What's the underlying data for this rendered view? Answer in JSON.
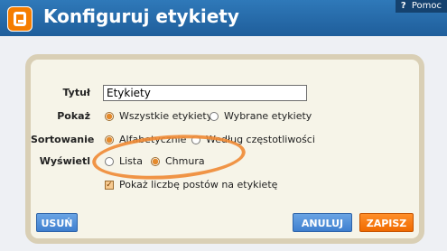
{
  "header": {
    "title": "Konfiguruj etykiety",
    "help_label": "Pomoc",
    "help_icon": "?"
  },
  "form": {
    "title_label": "Tytuł",
    "title_value": "Etykiety",
    "show_label": "Pokaż",
    "show_options": [
      "Wszystkie etykiety",
      "Wybrane etykiety"
    ],
    "sort_label": "Sortowanie",
    "sort_options": [
      "Alfabetycznie",
      "Według częstotliwości"
    ],
    "display_label": "Wyświetl",
    "display_options": [
      "Lista",
      "Chmura"
    ],
    "checkbox_label": "Pokaż liczbę postów na etykietę"
  },
  "buttons": {
    "delete": "USUŃ",
    "cancel": "ANULUJ",
    "save": "ZAPISZ"
  },
  "colors": {
    "header": "#2f79b9",
    "panel_bg": "#f6f4e8",
    "panel_border": "#d9cfb5",
    "accent_orange": "#f06a00",
    "button_blue": "#3f7fcf"
  }
}
